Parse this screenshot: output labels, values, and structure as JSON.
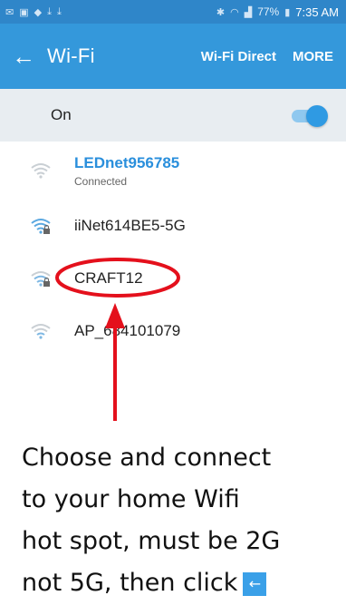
{
  "status_bar": {
    "battery": "77%",
    "time": "7:35 AM"
  },
  "app_bar": {
    "back_icon": "back-arrow-icon",
    "title": "Wi-Fi",
    "action_wifi_direct": "Wi-Fi Direct",
    "action_more": "MORE"
  },
  "toggle": {
    "label": "On",
    "state": "on"
  },
  "networks": [
    {
      "name": "LEDnet956785",
      "status": "Connected",
      "secured": false
    },
    {
      "name": "iiNet614BE5-5G",
      "status": "",
      "secured": true
    },
    {
      "name": "CRAFT12",
      "status": "",
      "secured": true
    },
    {
      "name": "AP_684101079",
      "status": "",
      "secured": false
    }
  ],
  "annotation": {
    "instruction_lines": [
      "Choose and connect",
      "to your home Wifi",
      "hot spot, must be 2G",
      "not 5G, then click"
    ],
    "inline_icon": "back-arrow-icon",
    "arrow_color": "#e4101c"
  },
  "colors": {
    "status_bar": "#2f86c9",
    "app_bar": "#3498db",
    "connected_text": "#2a8fdc",
    "toggle_row_bg": "#e8edf1"
  }
}
